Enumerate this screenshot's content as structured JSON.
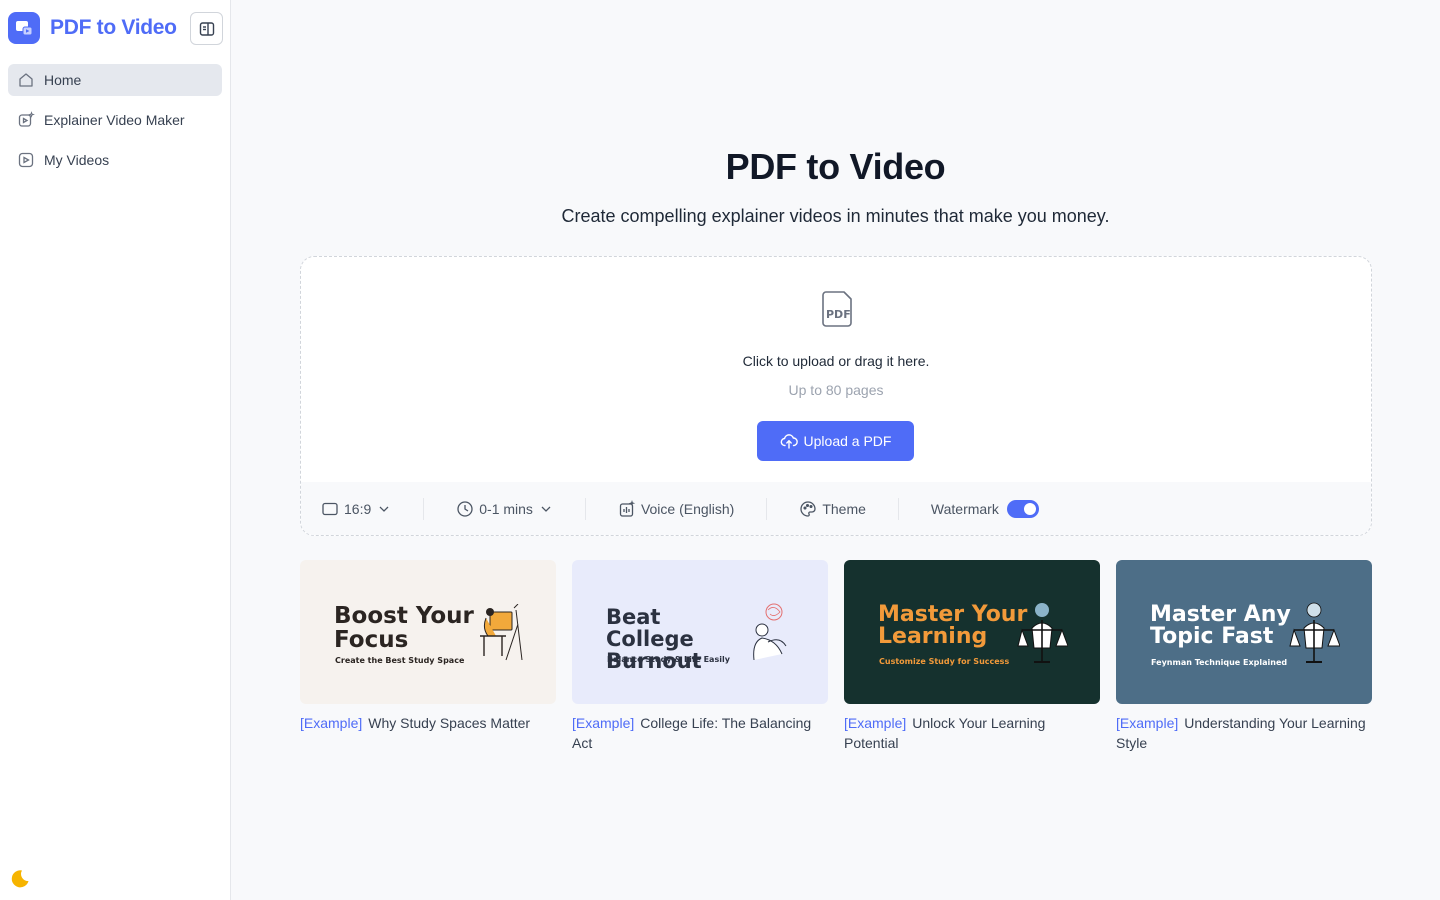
{
  "app": {
    "title": "PDF to Video"
  },
  "sidebar": {
    "items": [
      {
        "label": "Home",
        "icon": "home-icon",
        "active": true
      },
      {
        "label": "Explainer Video Maker",
        "icon": "video-sparkle-icon"
      },
      {
        "label": "My Videos",
        "icon": "play-square-icon"
      }
    ],
    "theme_icon": "moon-icon"
  },
  "hero": {
    "title": "PDF to Video",
    "subtitle": "Create compelling explainer videos in minutes that make you money."
  },
  "upload": {
    "hint": "Click to upload or drag it here.",
    "limit": "Up to 80 pages",
    "button_label": "Upload a PDF",
    "icon": "pdf-file-icon"
  },
  "options": {
    "aspect_ratio": "16:9",
    "duration": "0-1 mins",
    "voice": "Voice (English)",
    "theme": "Theme",
    "watermark": "Watermark",
    "watermark_enabled": true
  },
  "examples": [
    {
      "tag": "[Example]",
      "title": "Why Study Spaces Matter",
      "thumb_title": "Boost Your Focus",
      "thumb_subtitle": "Create the Best Study Space",
      "bg": "#f6f2ee",
      "title_color": "#2b2522",
      "sub_color": "#2b2522"
    },
    {
      "tag": "[Example]",
      "title": "College Life: The Balancing Act",
      "thumb_title": "Beat College Burnout",
      "thumb_subtitle": "Balance Study & Life Easily",
      "bg": "#e8ebfb",
      "title_color": "#2b3140",
      "sub_color": "#2b3140"
    },
    {
      "tag": "[Example]",
      "title": "Unlock Your Learning Potential",
      "thumb_title": "Master Your Learning",
      "thumb_subtitle": "Customize Study for Success",
      "bg": "#15312e",
      "title_color": "#f29a3a",
      "sub_color": "#f29a3a"
    },
    {
      "tag": "[Example]",
      "title": "Understanding Your Learning Style",
      "thumb_title": "Master Any Topic Fast",
      "thumb_subtitle": "Feynman Technique Explained",
      "bg": "#4d6e87",
      "title_color": "#ffffff",
      "sub_color": "#ffffff"
    }
  ],
  "colors": {
    "accent": "#4f6cf7",
    "sidebar_active": "#e5e8ee",
    "moon": "#f6b400"
  }
}
